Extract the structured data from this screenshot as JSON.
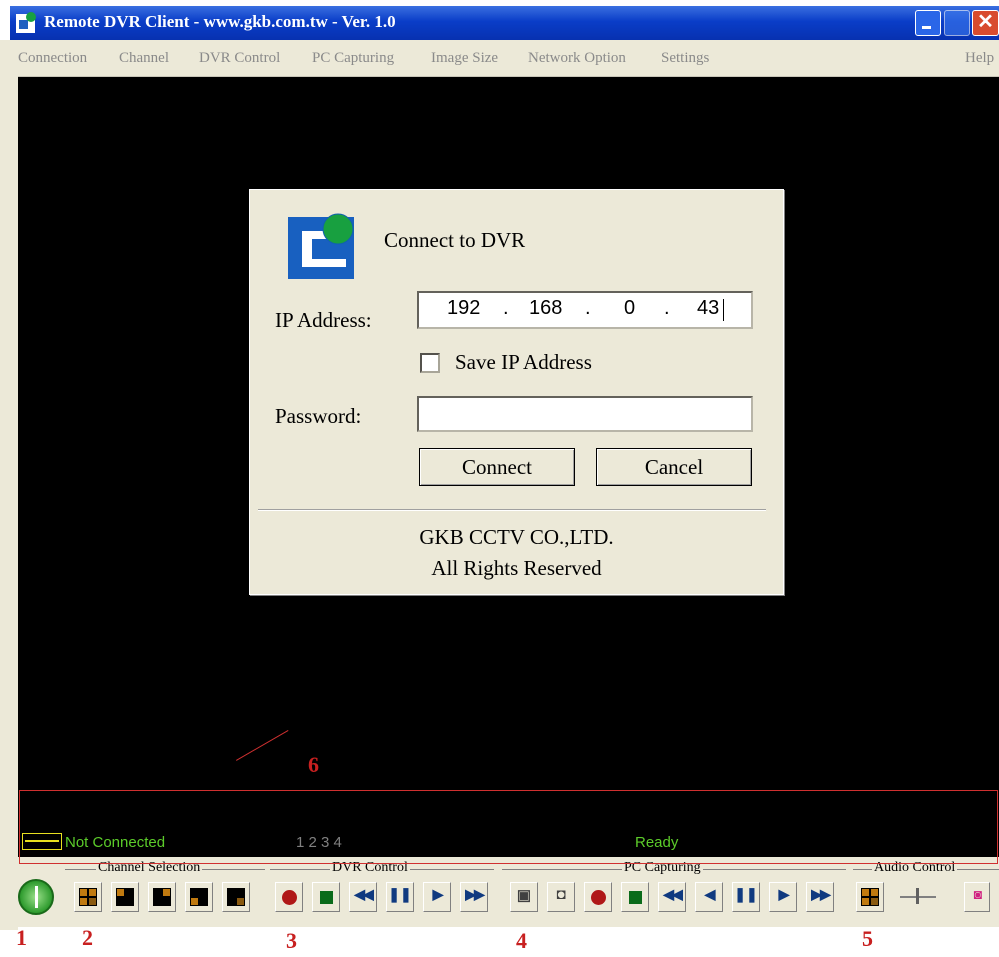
{
  "window": {
    "title": "Remote DVR Client - www.gkb.com.tw - Ver. 1.0"
  },
  "menu": {
    "items": [
      "Connection",
      "Channel",
      "DVR Control",
      "PC Capturing",
      "Image Size",
      "Network Option",
      "Settings"
    ],
    "help": "Help"
  },
  "dialog": {
    "heading": "Connect to DVR",
    "ip_label": "IP Address:",
    "ip": [
      "192",
      "168",
      "0",
      "43"
    ],
    "save_ip_label": "Save IP Address",
    "save_ip_checked": false,
    "password_label": "Password:",
    "password_value": "",
    "connect_label": "Connect",
    "cancel_label": "Cancel",
    "footer_line1": "GKB CCTV CO.,LTD.",
    "footer_line2": "All Rights Reserved"
  },
  "status": {
    "connection": "Not Connected",
    "channels": "1 2 3 4",
    "state": "Ready"
  },
  "toolbar": {
    "channel_selection_title": "Channel Selection",
    "dvr_control_title": "DVR Control",
    "pc_capturing_title": "PC Capturing",
    "audio_control_title": "Audio Control",
    "icons": {
      "power": "power-icon",
      "record": "record-icon",
      "stop": "stop-icon",
      "rewind": "rewind-icon",
      "pause": "pause-icon",
      "play": "play-icon",
      "fast_forward": "fast-forward-icon",
      "snapshot": "camera-icon",
      "video_capture": "video-camera-icon",
      "step_back": "step-back-icon"
    }
  },
  "annotations": {
    "labels": [
      "1",
      "2",
      "3",
      "4",
      "5",
      "6"
    ],
    "color": "#c82020"
  },
  "colors": {
    "titlebar": "#0a3dc8",
    "dialog_bg": "#ece9d8",
    "status_green": "#5ccc2a",
    "status_yellow": "#e8e020"
  }
}
